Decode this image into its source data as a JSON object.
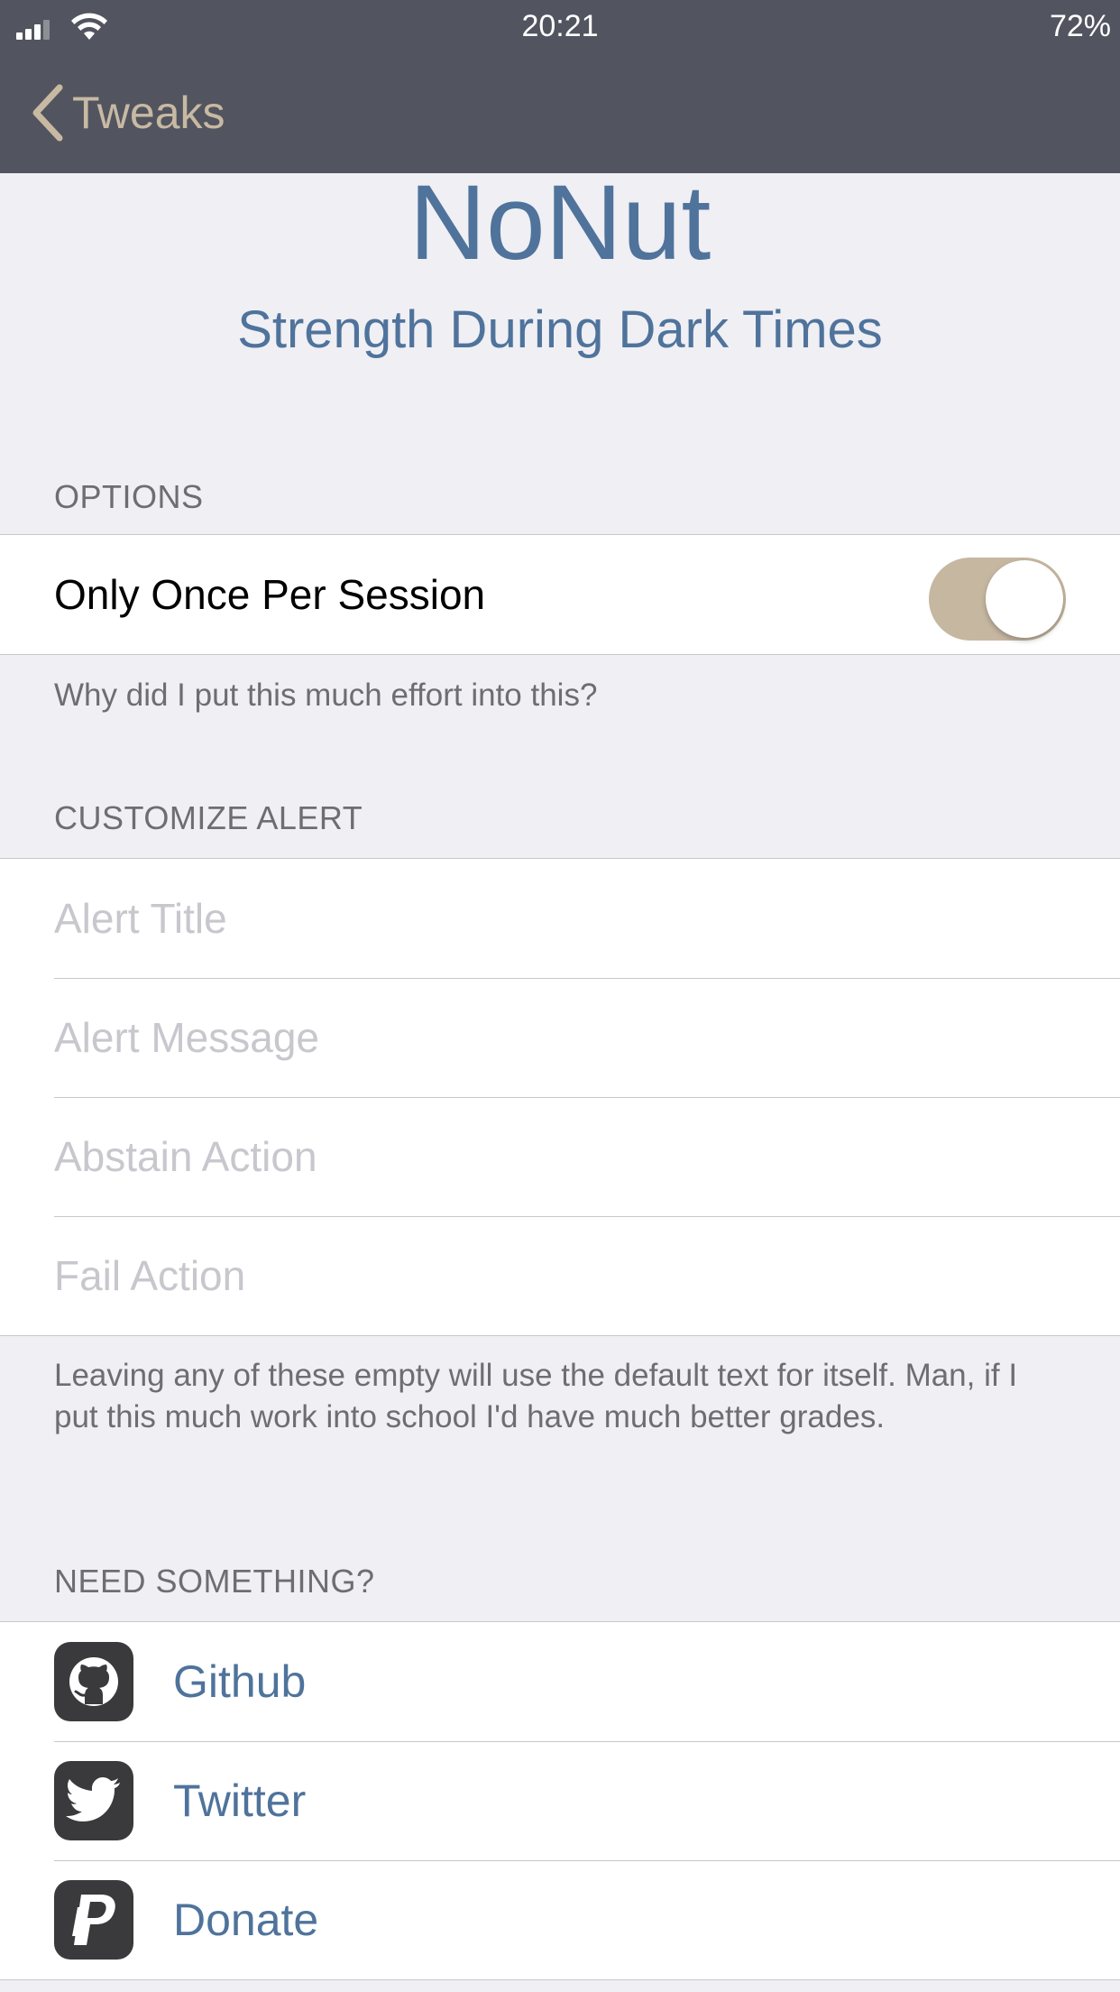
{
  "status_bar": {
    "time": "20:21",
    "battery": "72%"
  },
  "nav": {
    "back_label": "Tweaks"
  },
  "header": {
    "title": "NoNut",
    "subtitle": "Strength During Dark Times"
  },
  "options": {
    "header": "OPTIONS",
    "toggle_label": "Only Once Per Session",
    "toggle_on": true,
    "footer": "Why did I put this much effort into this?"
  },
  "customize": {
    "header": "CUSTOMIZE ALERT",
    "fields": [
      {
        "placeholder": "Alert Title",
        "value": ""
      },
      {
        "placeholder": "Alert Message",
        "value": ""
      },
      {
        "placeholder": "Abstain Action",
        "value": ""
      },
      {
        "placeholder": "Fail Action",
        "value": ""
      }
    ],
    "footer": "Leaving any of these empty will use the default text for itself. Man, if I put this much work into school I'd have much better grades."
  },
  "links": {
    "header": "NEED SOMETHING?",
    "items": [
      {
        "label": "Github",
        "icon": "github-icon"
      },
      {
        "label": "Twitter",
        "icon": "twitter-icon"
      },
      {
        "label": "Donate",
        "icon": "paypal-icon"
      }
    ]
  },
  "colors": {
    "nav_bg": "#52555f",
    "accent_tan": "#c6b7a1",
    "link_blue": "#4f739b",
    "group_bg": "#efeff4"
  }
}
